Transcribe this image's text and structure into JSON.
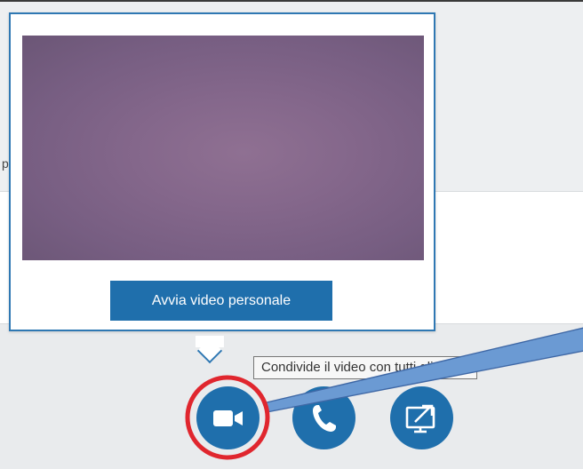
{
  "background": {
    "edge_fragment": "p"
  },
  "popup": {
    "start_video_label": "Avvia video personale"
  },
  "tooltip": {
    "text": "Condivide il video con tutti gli utenti"
  },
  "toolbar": {
    "buttons": [
      {
        "icon": "video-camera-icon",
        "color": "#1f6fac"
      },
      {
        "icon": "phone-icon",
        "color": "#1f6fac"
      },
      {
        "icon": "screen-share-icon",
        "color": "#1f6fac"
      }
    ]
  },
  "annotations": {
    "circle_color": "#e0262e",
    "arrow_color": "#6b9ad3"
  }
}
